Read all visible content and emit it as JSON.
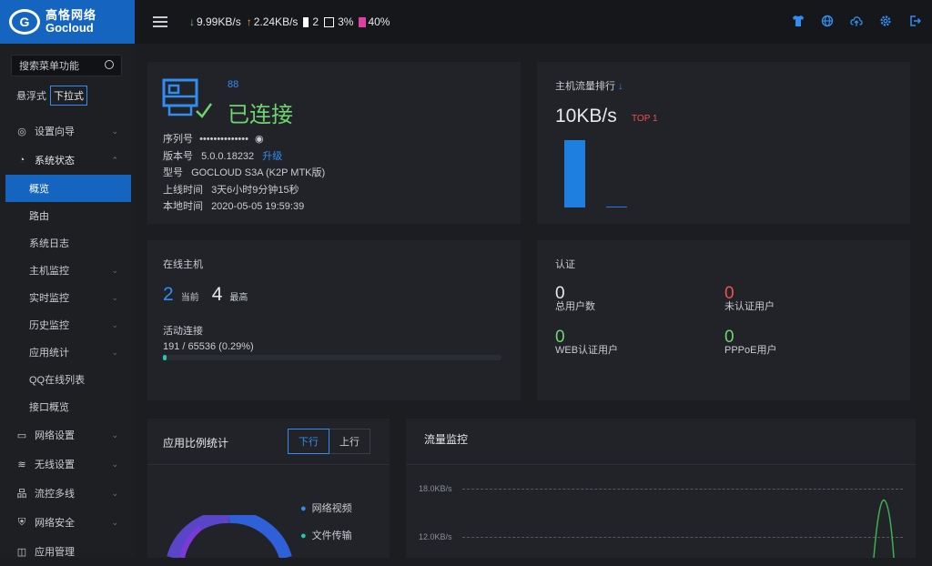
{
  "logo": {
    "cn": "高恪网络",
    "en": "Gocloud"
  },
  "topbar": {
    "down_speed": "9.99KB/s",
    "up_speed": "2.24KB/s",
    "count": "2",
    "cpu": "3%",
    "mem": "40%",
    "icons": [
      "shirt-icon",
      "globe-icon",
      "cloud-upload-icon",
      "gear-icon",
      "logout-icon"
    ]
  },
  "sidebar": {
    "search_placeholder": "搜索菜单功能",
    "mode_float": "悬浮式",
    "mode_dropdown": "下拉式",
    "setup": "设置向导",
    "status": "系统状态",
    "sub": [
      "概览",
      "路由",
      "系统日志",
      "主机监控",
      "实时监控",
      "历史监控",
      "应用统计",
      "QQ在线列表",
      "接口概览"
    ],
    "network": "网络设置",
    "wireless": "无线设置",
    "flowctrl": "流控多线",
    "security": "网络安全",
    "app_mgmt": "应用管理"
  },
  "device": {
    "count_label": "88",
    "status": "已连接",
    "serial_label": "序列号",
    "serial_value": "••••••••••••••",
    "version_label": "版本号",
    "version_value": "5.0.0.18232",
    "upgrade": "升级",
    "model_label": "型号",
    "model_value": "GOCLOUD S3A (K2P MTK版)",
    "uptime_label": "上线时间",
    "uptime_value": "3天6小时9分钟15秒",
    "localtime_label": "本地时间",
    "localtime_value": "2020-05-05 19:59:39"
  },
  "ranking": {
    "title": "主机流量排行",
    "value": "10KB/s",
    "top": "TOP 1",
    "bars": [
      1.0,
      0.02
    ]
  },
  "hosts": {
    "title": "在线主机",
    "current": "2",
    "current_label": "当前",
    "max": "4",
    "max_label": "最高",
    "conn_label": "活动连接",
    "conn_value": "191 / 65536 (0.29%)",
    "conn_fraction": 0.0029
  },
  "auth": {
    "title": "认证",
    "total": "0",
    "total_label": "总用户数",
    "unauth": "0",
    "unauth_label": "未认证用户",
    "web": "0",
    "web_label": "WEB认证用户",
    "pppoe": "0",
    "pppoe_label": "PPPoE用户"
  },
  "appstats": {
    "title": "应用比例统计",
    "tab_down": "下行",
    "tab_up": "上行",
    "legend": [
      {
        "name": "网络视频",
        "color": "#2f8ef0"
      },
      {
        "name": "文件传输",
        "color": "#1fc7b5"
      }
    ]
  },
  "traffic": {
    "title": "流量监控",
    "y_top": "18.0KB/s",
    "y_mid": "12.0KB/s"
  },
  "colors": {
    "accent": "#1565c0",
    "ok": "#6fd46f",
    "warn": "#f05050"
  }
}
